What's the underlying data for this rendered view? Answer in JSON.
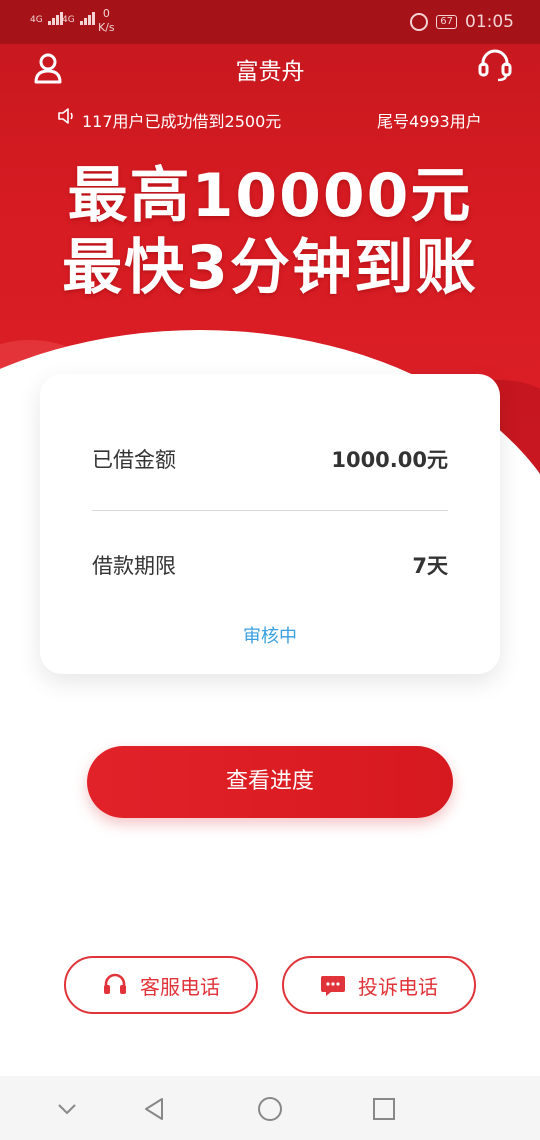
{
  "status_bar": {
    "signal1": "4G",
    "signal2": "4G",
    "net_speed_value": "0",
    "net_speed_unit": "K/s",
    "battery": "67",
    "time": "01:05"
  },
  "nav": {
    "title": "富贵舟"
  },
  "ticker": {
    "message1": "117用户已成功借到2500元",
    "message2": "尾号4993用户"
  },
  "headline": {
    "line1": "最高10000元",
    "line2": "最快3分钟到账"
  },
  "loan_card": {
    "amount_label": "已借金额",
    "amount_value": "1000.00元",
    "term_label": "借款期限",
    "term_value": "7天",
    "status": "审核中"
  },
  "actions": {
    "view_progress": "查看进度",
    "customer_service": "客服电话",
    "complaint": "投诉电话"
  },
  "colors": {
    "brand_red": "#d6191f",
    "status_blue": "#3aa0e0"
  },
  "icons": [
    "user-icon",
    "headset-icon",
    "speaker-icon",
    "chat-icon",
    "back-icon",
    "home-icon",
    "recents-icon",
    "chevron-down-icon"
  ]
}
